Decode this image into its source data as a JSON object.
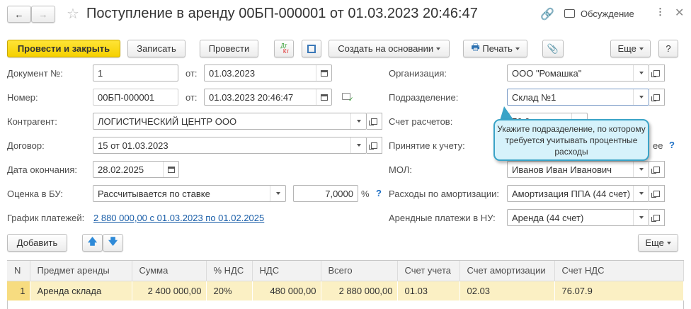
{
  "title": "Поступление в аренду 00БП-000001 от 01.03.2023 20:46:47",
  "header": {
    "discussion": "Обсуждение"
  },
  "toolbar": {
    "post_close": "Провести и закрыть",
    "save": "Записать",
    "post": "Провести",
    "dtkt_top": "Дт",
    "dtkt_bottom": "Кт",
    "create_based": "Создать на основании",
    "print": "Печать",
    "more": "Еще",
    "help": "?"
  },
  "form": {
    "doc_no_label": "Документ №:",
    "doc_no": "1",
    "from_label": "от:",
    "doc_date": "01.03.2023",
    "number_label": "Номер:",
    "number": "00БП-000001",
    "number_date": "01.03.2023 20:46:47",
    "counterparty_label": "Контрагент:",
    "counterparty": "ЛОГИСТИЧЕСКИЙ ЦЕНТР ООО",
    "contract_label": "Договор:",
    "contract": "15 от 01.03.2023",
    "end_date_label": "Дата окончания:",
    "end_date": "28.02.2025",
    "valuation_label": "Оценка в БУ:",
    "valuation": "Рассчитывается по ставке",
    "rate": "7,0000",
    "percent": "%",
    "schedule_label": "График платежей:",
    "schedule": "2 880 000,00 с 01.03.2023 по 01.02.2025",
    "org_label": "Организация:",
    "org": "ООО \"Ромашка\"",
    "division_label": "Подразделение:",
    "division": "Склад №1",
    "account_label": "Счет расчетов:",
    "account": "76.0",
    "accept_label": "Принятие к учету:",
    "accept_tail": "ее",
    "mol_label": "МОЛ:",
    "mol": "Иванов Иван Иванович",
    "amort_label": "Расходы по амортизации:",
    "amort": "Амортизация ППА (44 счет)",
    "rent_nu_label": "Арендные платежи в НУ:",
    "rent_nu": "Аренда (44 счет)"
  },
  "tooltip": "Укажите подразделение, по которому требуется учитывать процентные расходы",
  "table_toolbar": {
    "add": "Добавить",
    "more": "Еще"
  },
  "table": {
    "columns": [
      "N",
      "Предмет аренды",
      "Сумма",
      "% НДС",
      "НДС",
      "Всего",
      "Счет учета",
      "Счет амортизации",
      "Счет НДС"
    ],
    "rows": [
      [
        "1",
        "Аренда склада",
        "2 400 000,00",
        "20%",
        "480 000,00",
        "2 880 000,00",
        "01.03",
        "02.03",
        "76.07.9"
      ]
    ]
  },
  "colors": {
    "primary_button": "#f5d000",
    "selected_row": "#fbf0c4",
    "tooltip_bg": "#d6f2fb",
    "tooltip_border": "#3aa3c7",
    "link": "#1a5ea8"
  }
}
